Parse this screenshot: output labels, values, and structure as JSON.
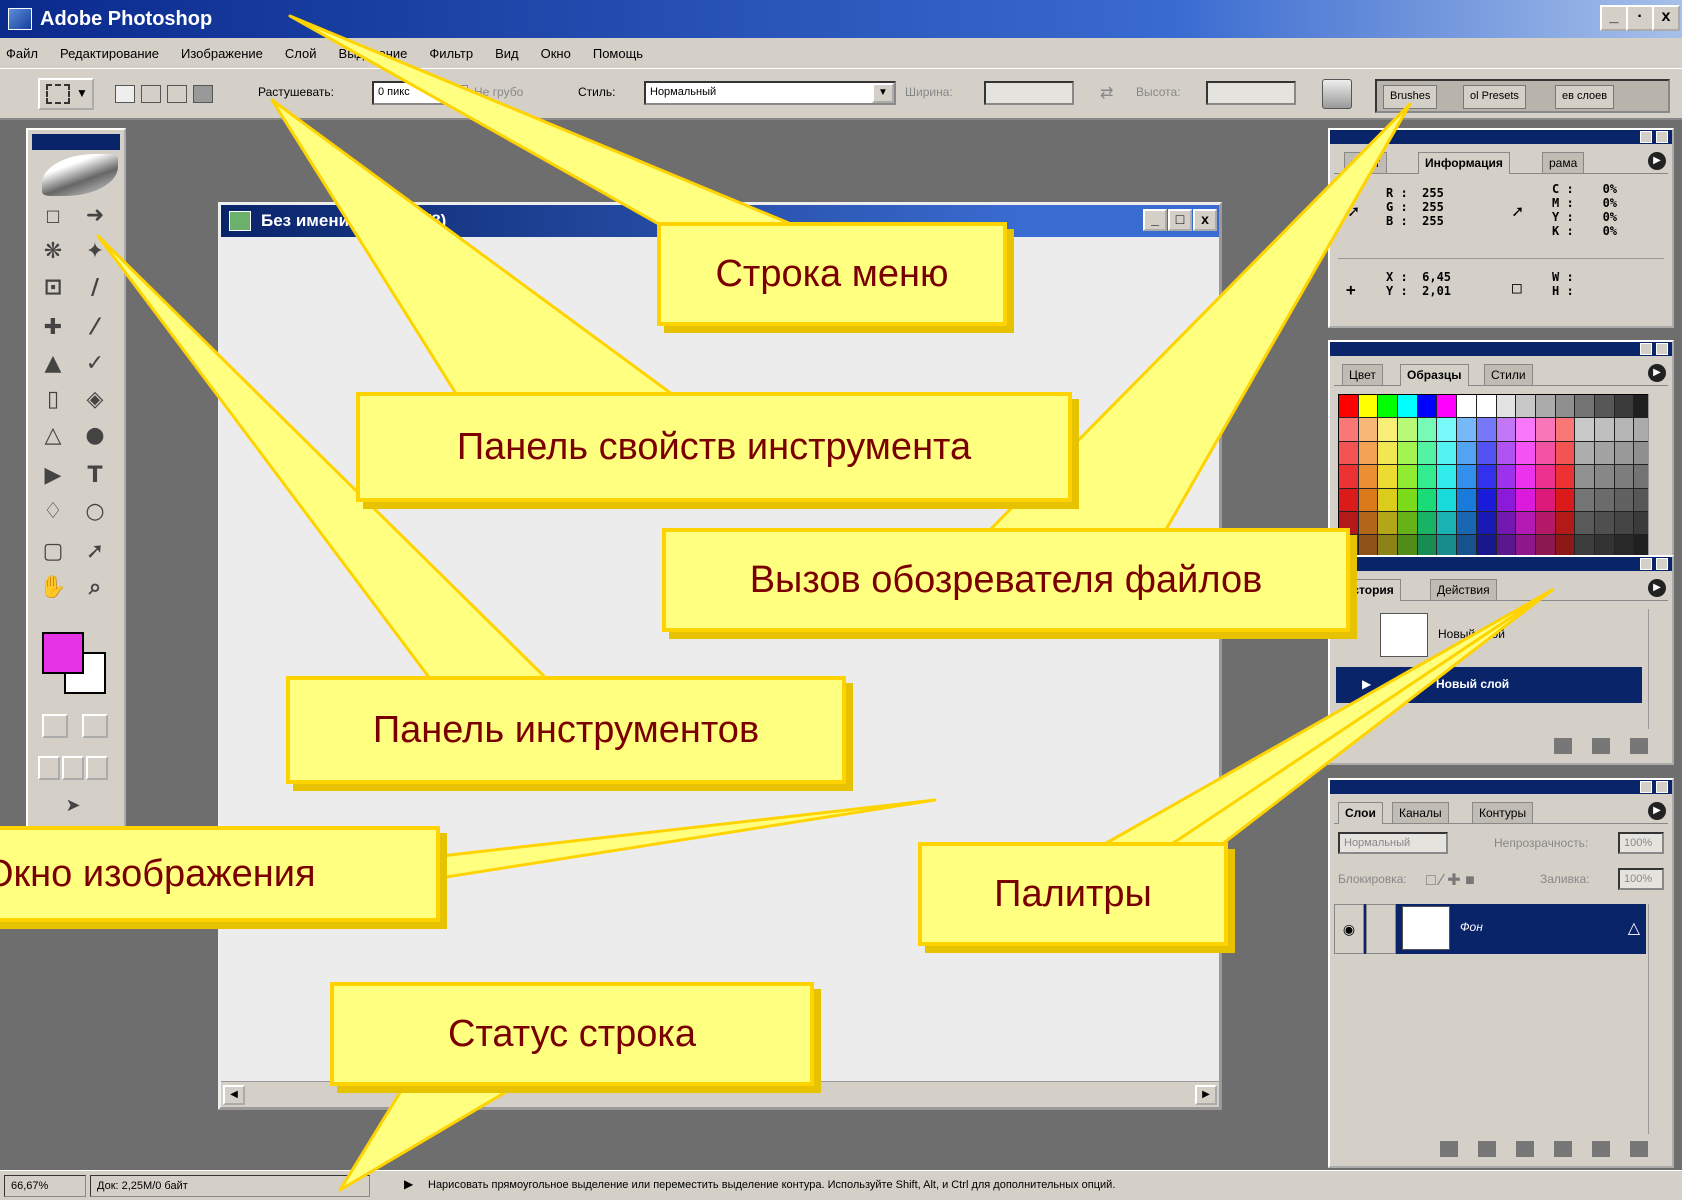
{
  "app": {
    "title": "Adobe Photoshop",
    "controls": [
      "_",
      "·",
      "x"
    ]
  },
  "menu": [
    "Файл",
    "Редактирование",
    "Изображение",
    "Слой",
    "Выделение",
    "Фильтр",
    "Вид",
    "Окно",
    "Помощь"
  ],
  "options": {
    "feather_label": "Растушевать:",
    "feather_value": "0 пикс",
    "antialias_label": "Не грубо",
    "style_label": "Стиль:",
    "style_value": "Нормальный",
    "width_label": "Ширина:",
    "height_label": "Высота:"
  },
  "palette_well": {
    "tabs": [
      "Brushes",
      "ol Presets",
      "ев слоев"
    ]
  },
  "document": {
    "title": "Без имени...% (RGB/8)"
  },
  "info": {
    "tabs": [
      "вигат",
      "Информация",
      "рама"
    ],
    "rgb": "R :  255\nG :  255\nB :  255",
    "cmyk": "C :    0%\nM :    0%\nY :    0%\nK :    0%",
    "xy": "X :  6,45\nY :  2,01",
    "wh": "W :\nH :"
  },
  "color_panel": {
    "tabs": [
      "Цвет",
      "Образцы",
      "Стили"
    ]
  },
  "history": {
    "tabs": [
      "история",
      "Действия"
    ],
    "items": [
      "Новый слой",
      "Новый слой"
    ]
  },
  "layers": {
    "tabs": [
      "Слои",
      "Каналы",
      "Контуры"
    ],
    "blend": "Нормальный",
    "opacity_label": "Непрозрачность:",
    "opacity": "100%",
    "lock_label": "Блокировка:",
    "fill_label": "Заливка:",
    "fill": "100%",
    "layer_name": "Фон"
  },
  "status": {
    "zoom": "66,67%",
    "doc": "Док: 2,25M/0 байт",
    "hint": "Нарисовать прямоугольное выделение или переместить выделение контура. Используйте Shift, Alt, и Ctrl для дополнительных опций."
  },
  "callouts": {
    "menu_bar": "Строка меню",
    "options_bar": "Панель свойств инструмента",
    "file_browser": "Вызов обозревателя файлов",
    "toolbox": "Панель инструментов",
    "image_window": "Окно изображения",
    "palettes": "Палитры",
    "status_bar": "Статус строка"
  },
  "colors": {
    "foreground": "#e633e6",
    "background": "#ffffff",
    "callout_fill": "#ffff80",
    "callout_border": "#ffd300",
    "callout_text": "#7a0000",
    "title_bar": "#0a246a"
  },
  "icons": [
    "photoshop-app-icon",
    "marquee-icon",
    "move-icon",
    "lasso-icon",
    "magic-wand-icon",
    "crop-icon",
    "slice-icon",
    "healing-brush-icon",
    "brush-icon",
    "stamp-icon",
    "history-brush-icon",
    "eraser-icon",
    "paint-bucket-icon",
    "blur-icon",
    "dodge-icon",
    "path-select-icon",
    "type-icon",
    "pen-icon",
    "shape-icon",
    "notes-icon",
    "eyedropper-icon",
    "hand-icon",
    "zoom-icon",
    "file-browser-icon"
  ]
}
